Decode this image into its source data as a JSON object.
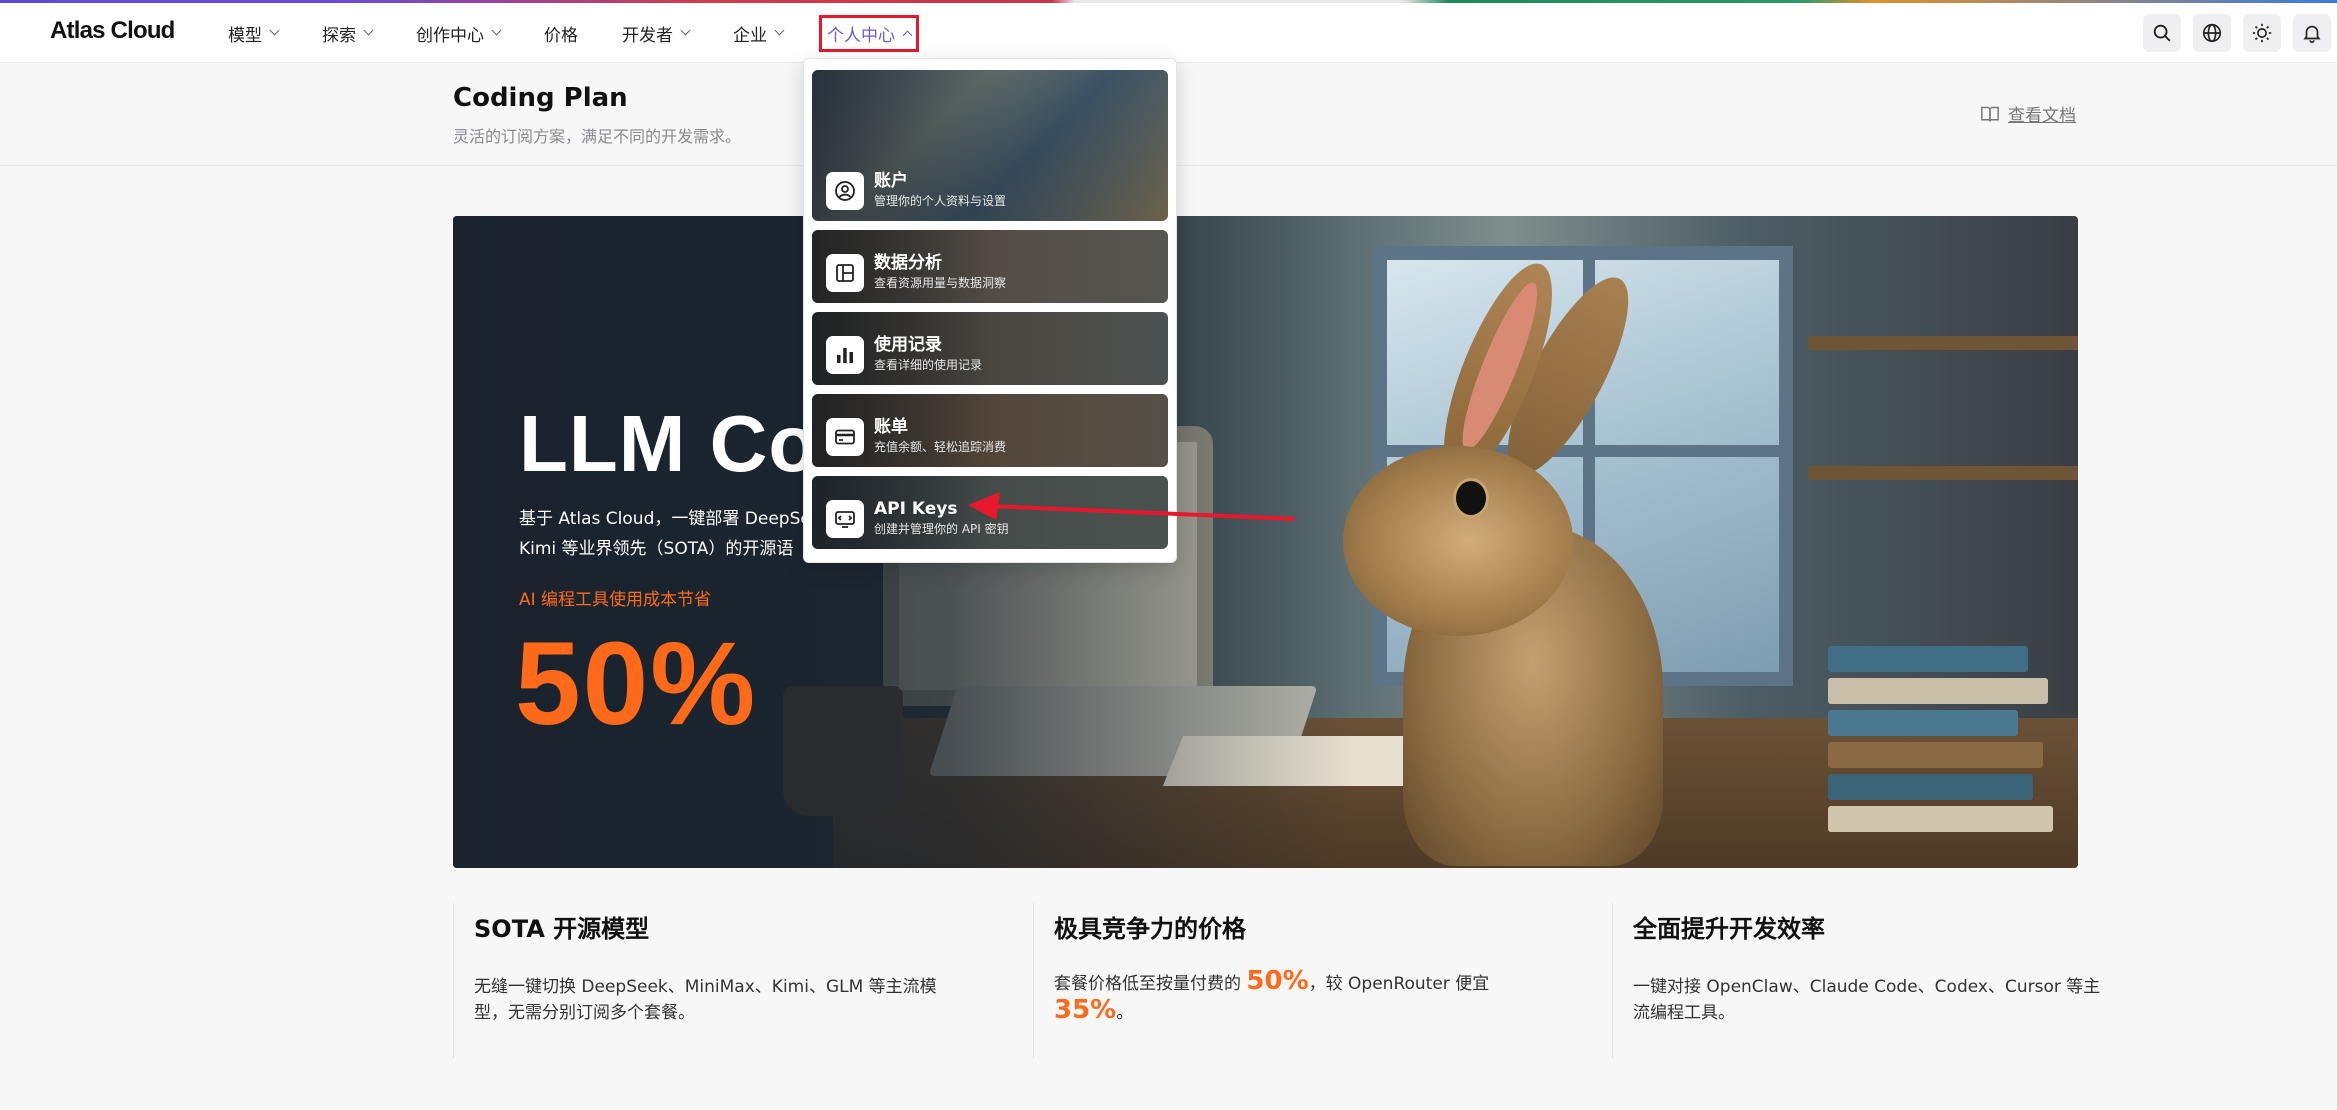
{
  "header": {
    "logo": "Atlas Cloud",
    "nav": [
      {
        "label": "模型",
        "has_dropdown": true
      },
      {
        "label": "探索",
        "has_dropdown": true
      },
      {
        "label": "创作中心",
        "has_dropdown": true
      },
      {
        "label": "价格",
        "has_dropdown": false
      },
      {
        "label": "开发者",
        "has_dropdown": true
      },
      {
        "label": "企业",
        "has_dropdown": true
      },
      {
        "label": "个人中心",
        "has_dropdown": true,
        "active": true
      }
    ],
    "icons": [
      "search-icon",
      "globe-icon",
      "sun-icon",
      "bell-icon"
    ]
  },
  "page": {
    "title": "Coding Plan",
    "subtitle": "灵活的订阅方案，满足不同的开发需求。",
    "docs_link": "查看文档"
  },
  "hero": {
    "title": "LLM Co",
    "desc_line1": "基于 Atlas Cloud，一键部署 DeepSe",
    "desc_line2": "Kimi 等业界领先（SOTA）的开源语",
    "save_label": "AI 编程工具使用成本节省",
    "big_number": "50%"
  },
  "dropdown": {
    "items": [
      {
        "title": "账户",
        "subtitle": "管理你的个人资料与设置",
        "icon": "user-circle-icon"
      },
      {
        "title": "数据分析",
        "subtitle": "查看资源用量与数据洞察",
        "icon": "layout-panel-icon"
      },
      {
        "title": "使用记录",
        "subtitle": "查看详细的使用记录",
        "icon": "bar-chart-icon"
      },
      {
        "title": "账单",
        "subtitle": "充值余额、轻松追踪消费",
        "icon": "credit-card-icon"
      },
      {
        "title": "API Keys",
        "subtitle": "创建并管理你的 API 密钥",
        "icon": "key-screen-icon"
      }
    ]
  },
  "features": [
    {
      "title": "SOTA 开源模型",
      "text": "无缝一键切换 DeepSeek、MiniMax、Kimi、GLM 等主流模型，无需分别订阅多个套餐。"
    },
    {
      "title": "极具竞争力的价格",
      "text_a": "套餐价格低至按量付费的 ",
      "hl1": "50%",
      "text_b": "，较 OpenRouter 便宜",
      "hl2": "35%",
      "text_c": "。"
    },
    {
      "title": "全面提升开发效率",
      "text": "一键对接 OpenClaw、Claude Code、Codex、Cursor 等主流编程工具。"
    }
  ],
  "colors": {
    "accent_orange": "#ff6a1a",
    "active_nav": "#6b5bd6",
    "highlight_box": "#e8172b"
  }
}
